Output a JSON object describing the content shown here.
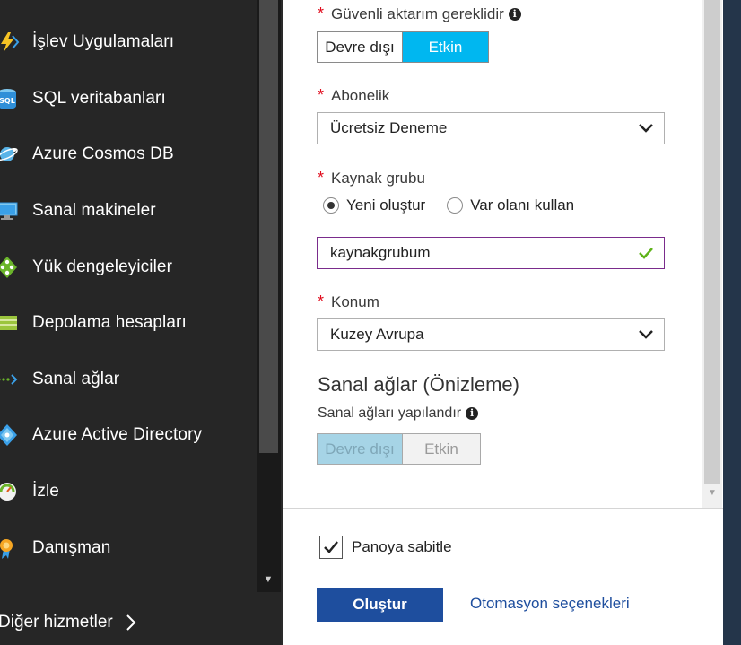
{
  "sidebar": {
    "items": [
      {
        "label": "İşlev Uygulamaları",
        "icon": "lightning-icon"
      },
      {
        "label": "SQL veritabanları",
        "icon": "sql-database-icon"
      },
      {
        "label": "Azure Cosmos DB",
        "icon": "cosmos-db-icon"
      },
      {
        "label": "Sanal makineler",
        "icon": "virtual-machine-icon"
      },
      {
        "label": "Yük dengeleyiciler",
        "icon": "load-balancer-icon"
      },
      {
        "label": "Depolama hesapları",
        "icon": "storage-account-icon"
      },
      {
        "label": "Sanal ağlar",
        "icon": "virtual-network-icon"
      },
      {
        "label": "Azure Active Directory",
        "icon": "active-directory-icon"
      },
      {
        "label": "İzle",
        "icon": "monitor-icon"
      },
      {
        "label": "Danışman",
        "icon": "advisor-icon"
      }
    ],
    "more_services_label": "Diğer hizmetler"
  },
  "form": {
    "secure_transfer": {
      "label": "Güvenli aktarım gereklidir",
      "options": [
        "Devre dışı",
        "Etkin"
      ],
      "selected": "Etkin"
    },
    "subscription": {
      "label": "Abonelik",
      "value": "Ücretsiz Deneme"
    },
    "resource_group": {
      "label": "Kaynak grubu",
      "radio_new": "Yeni oluştur",
      "radio_existing": "Var olanı kullan",
      "selected": "Yeni oluştur",
      "input_value": "kaynakgrubum"
    },
    "location": {
      "label": "Konum",
      "value": "Kuzey Avrupa"
    },
    "virtual_networks": {
      "title": "Sanal ağlar (Önizleme)",
      "label": "Sanal ağları yapılandır",
      "options": [
        "Devre dışı",
        "Etkin"
      ],
      "selected": "Devre dışı"
    }
  },
  "footer": {
    "pin_label": "Panoya sabitle",
    "pin_checked": true,
    "create_label": "Oluştur",
    "automation_label": "Otomasyon seçenekleri"
  },
  "colors": {
    "sidebar_bg": "#262626",
    "accent": "#00b7f0",
    "primary": "#1e4e9e",
    "required": "#e00b1c",
    "valid_check": "#5fb31a",
    "input_focus": "#7a2c8c"
  }
}
